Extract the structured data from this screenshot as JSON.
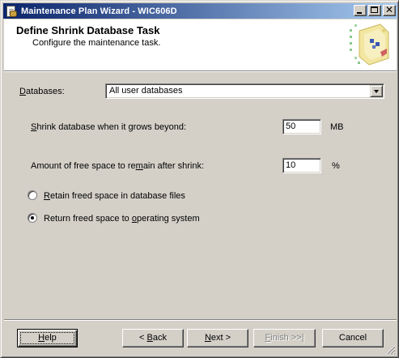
{
  "window": {
    "title": "Maintenance Plan Wizard - WIC606D"
  },
  "header": {
    "title": "Define Shrink Database Task",
    "subtitle": "Configure the maintenance task."
  },
  "form": {
    "databases": {
      "label_accel": "D",
      "label_rest": "atabases:",
      "value": "All user databases"
    },
    "shrink_beyond": {
      "label_accel": "S",
      "label_rest": "hrink database when it grows beyond:",
      "value": "50",
      "unit": "MB"
    },
    "free_space": {
      "label_pre": "Amount of free space to re",
      "label_accel": "m",
      "label_rest": "ain after shrink:",
      "value": "10",
      "unit": "%"
    },
    "retain_option": {
      "label_accel": "R",
      "label_rest": "etain freed space in database files",
      "selected": false
    },
    "return_option": {
      "label_pre": "Return freed space to ",
      "label_accel": "o",
      "label_rest": "perating system",
      "selected": true
    }
  },
  "buttons": {
    "help": {
      "accel": "H",
      "rest": "elp"
    },
    "back": {
      "pre": "< ",
      "accel": "B",
      "rest": "ack"
    },
    "next": {
      "accel": "N",
      "rest": "ext >"
    },
    "finish": {
      "accel": "F",
      "rest": "inish >>|",
      "enabled": false
    },
    "cancel": {
      "label": "Cancel"
    }
  }
}
